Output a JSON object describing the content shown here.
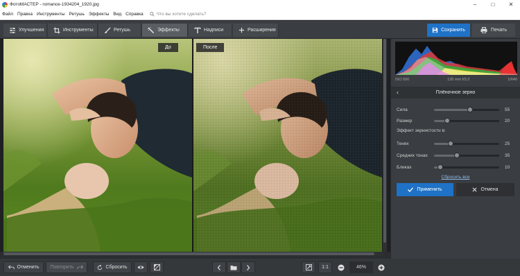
{
  "window": {
    "title": "ФотоМАСТЕР - romance-1934204_1920.jpg",
    "controls": [
      "–",
      "□",
      "✕"
    ]
  },
  "menu": {
    "items": [
      "Файл",
      "Правка",
      "Инструменты",
      "Ретушь",
      "Эффекты",
      "Вид",
      "Справка"
    ],
    "search_placeholder": "Что вы хотите сделать?"
  },
  "toolbar": {
    "tabs": [
      {
        "label": "Улучшения",
        "icon": "sliders-icon"
      },
      {
        "label": "Инструменты",
        "icon": "crop-icon"
      },
      {
        "label": "Ретушь",
        "icon": "brush-icon"
      },
      {
        "label": "Эффекты",
        "icon": "magic-wand-icon"
      },
      {
        "label": "Надписи",
        "icon": "text-icon"
      },
      {
        "label": "Расширения",
        "icon": "plus-icon"
      }
    ],
    "active_tab": "Эффекты",
    "save_label": "Сохранить",
    "print_label": "Печать"
  },
  "canvas": {
    "before_label": "До",
    "after_label": "После"
  },
  "bottombar": {
    "undo_label": "Отменить",
    "redo_label": "Повторить",
    "reset_label": "Сбросить",
    "ratio_label": "1:1",
    "zoom": "46%"
  },
  "histogram": {
    "iso": "ISO 500",
    "lens": "135 mm f/3.2",
    "shutter": "1/640"
  },
  "panel": {
    "title": "Плёночное зерно",
    "section_label": "Эффект зернистости в:",
    "sliders": [
      {
        "label": "Сила",
        "value": 55,
        "fraction": 0.55
      },
      {
        "label": "Размер",
        "value": 20,
        "fraction": 0.2
      }
    ],
    "grain_sliders": [
      {
        "label": "Тенях",
        "value": 25,
        "fraction": 0.25
      },
      {
        "label": "Средних тонах",
        "value": 35,
        "fraction": 0.35
      },
      {
        "label": "Бликах",
        "value": 10,
        "fraction": 0.1
      }
    ],
    "reset_all_label": "Сбросить все",
    "apply_label": "Применить",
    "cancel_label": "Отмена"
  },
  "colors": {
    "accent": "#1f72c6",
    "panel_bg": "#3a3d41",
    "app_bg": "#2b2d30"
  }
}
